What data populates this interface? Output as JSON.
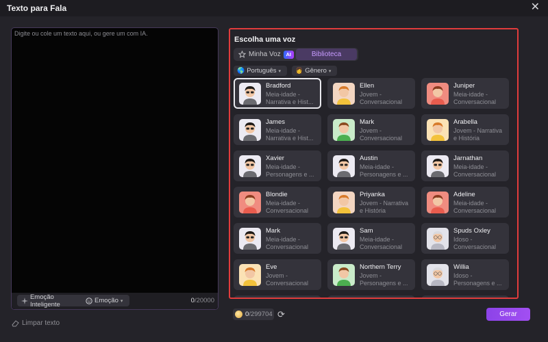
{
  "window": {
    "title": "Texto para Fala"
  },
  "editor": {
    "placeholder": "Digite ou cole um texto aqui, ou gere um com IA.",
    "value": "",
    "emotion_ai_label": "Emoção Inteligente",
    "emotion_label": "Emoção",
    "char_count": "0",
    "char_limit": "/20000",
    "clear_label": "Limpar texto"
  },
  "voice_panel": {
    "title": "Escolha uma voz",
    "tabs": {
      "my_voice": "Minha Voz",
      "ai_badge": "AI",
      "library": "Biblioteca"
    },
    "filters": {
      "language": "Português",
      "gender": "Gênero"
    },
    "selected": "Bradford",
    "voices": [
      {
        "name": "Bradford",
        "desc": "Meia-idade - Narrativa e Hist...",
        "avatar": "man-dark-hair",
        "bg": "#eceaf2"
      },
      {
        "name": "Ellen",
        "desc": "Jovem - Conversacional",
        "avatar": "woman-yellow",
        "bg": "#f3d6c2"
      },
      {
        "name": "Juniper",
        "desc": "Meia-idade - Conversacional",
        "avatar": "woman-red",
        "bg": "#f08c80"
      },
      {
        "name": "James",
        "desc": "Meia-idade - Narrativa e Hist...",
        "avatar": "man-dark-hair",
        "bg": "#eceaf2"
      },
      {
        "name": "Mark",
        "desc": "Jovem - Conversacional",
        "avatar": "man-green",
        "bg": "#c9ebc9"
      },
      {
        "name": "Arabella",
        "desc": "Jovem - Narrativa e História",
        "avatar": "woman-yellow",
        "bg": "#fbe2b5"
      },
      {
        "name": "Xavier",
        "desc": "Meia-idade - Personagens e ...",
        "avatar": "man-dark-hair",
        "bg": "#eceaf2"
      },
      {
        "name": "Austin",
        "desc": "Meia-idade - Personagens e ...",
        "avatar": "man-dark-hair",
        "bg": "#eceaf2"
      },
      {
        "name": "Jarnathan",
        "desc": "Meia-idade - Conversacional",
        "avatar": "man-dark-hair",
        "bg": "#eceaf2"
      },
      {
        "name": "Blondie",
        "desc": "Meia-idade - Conversacional",
        "avatar": "woman-red",
        "bg": "#f08c80"
      },
      {
        "name": "Priyanka",
        "desc": "Jovem - Narrativa e História",
        "avatar": "woman-yellow",
        "bg": "#f3d6c2"
      },
      {
        "name": "Adeline",
        "desc": "Meia-idade - Conversacional",
        "avatar": "woman-red",
        "bg": "#f08c80"
      },
      {
        "name": "Mark",
        "desc": "Meia-idade - Conversacional",
        "avatar": "man-dark-hair",
        "bg": "#eceaf2"
      },
      {
        "name": "Sam",
        "desc": "Meia-idade - Conversacional",
        "avatar": "man-dark-hair",
        "bg": "#eceaf2"
      },
      {
        "name": "Spuds Oxley",
        "desc": "Idoso - Conversacional",
        "avatar": "elder",
        "bg": "#e3e3ea"
      },
      {
        "name": "Eve",
        "desc": "Jovem - Conversacional",
        "avatar": "woman-yellow",
        "bg": "#fbe2b5"
      },
      {
        "name": "Northern Terry",
        "desc": "Jovem - Personagens e ...",
        "avatar": "man-green",
        "bg": "#c9ebc9"
      },
      {
        "name": "Willia",
        "desc": "Idoso - Personagens e ...",
        "avatar": "elder",
        "bg": "#e3e3ea"
      }
    ]
  },
  "footer": {
    "credits_used": "0",
    "credits_total": "/299704",
    "generate_label": "Gerar"
  },
  "colors": {
    "accent": "#a24ff2",
    "highlight_border": "#e23c3c",
    "background": "#242329"
  }
}
